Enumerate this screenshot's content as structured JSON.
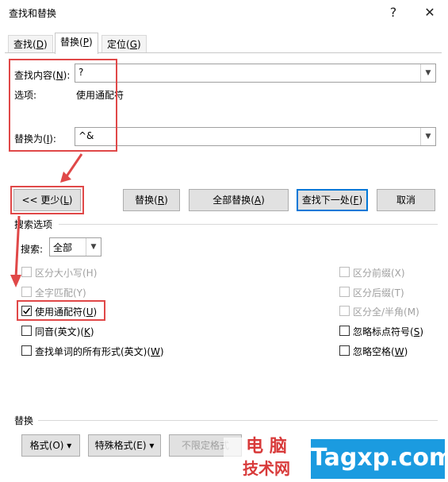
{
  "window": {
    "title": "查找和替换",
    "help": "?",
    "close": "✕"
  },
  "tabs": [
    {
      "label": "查找(",
      "key": "D",
      "suffix": ")"
    },
    {
      "label": "替换(",
      "key": "P",
      "suffix": ")"
    },
    {
      "label": "定位(",
      "key": "G",
      "suffix": ")"
    }
  ],
  "find": {
    "label": "查找内容(",
    "key": "N",
    "suffix": "):",
    "value": "?"
  },
  "options": {
    "label": "选项:",
    "value": "使用通配符"
  },
  "replace": {
    "label": "替换为(",
    "key": "I",
    "suffix": "):",
    "value": "^&"
  },
  "buttons": {
    "less": {
      "label": "<< 更少(",
      "key": "L",
      "suffix": ")"
    },
    "replace": {
      "label": "替换(",
      "key": "R",
      "suffix": ")"
    },
    "replace_all": {
      "label": "全部替换(",
      "key": "A",
      "suffix": ")"
    },
    "find_next": {
      "label": "查找下一处(",
      "key": "F",
      "suffix": ")"
    },
    "cancel": "取消"
  },
  "search_options": {
    "heading": "搜索选项",
    "search_label": "搜索",
    "search_key": ":",
    "search_value": "全部"
  },
  "checkboxes_left": [
    {
      "label": "区分大小写(H)",
      "checked": false,
      "disabled": true
    },
    {
      "label": "全字匹配(Y)",
      "checked": false,
      "disabled": true
    },
    {
      "label": "使用通配符(",
      "key": "U",
      "suffix": ")",
      "checked": true,
      "disabled": false
    },
    {
      "label": "同音(英文)(",
      "key": "K",
      "suffix": ")",
      "checked": false,
      "disabled": false
    },
    {
      "label": "查找单词的所有形式(英文)(",
      "key": "W",
      "suffix": ")",
      "checked": false,
      "disabled": false
    }
  ],
  "checkboxes_right": [
    {
      "label": "区分前缀(X)",
      "checked": false,
      "disabled": true
    },
    {
      "label": "区分后缀(T)",
      "checked": false,
      "disabled": true
    },
    {
      "label": "区分全/半角(M)",
      "checked": false,
      "disabled": true
    },
    {
      "label": "忽略标点符号(",
      "key": "S",
      "suffix": ")",
      "checked": false,
      "disabled": false
    },
    {
      "label": "忽略空格(",
      "key": "W",
      "suffix": ")",
      "checked": false,
      "disabled": false
    }
  ],
  "replace_section": {
    "heading": "替换",
    "format": "格式(O) ▾",
    "special": "特殊格式(E) ▾",
    "no_format": "不限定格式"
  },
  "watermark": {
    "cn1": "电 脑",
    "cn2": "技术网",
    "en": "Tagxp.com"
  },
  "colors": {
    "accent": "#0078d7",
    "highlight": "#e04848",
    "watermark": "#1b9be0"
  }
}
